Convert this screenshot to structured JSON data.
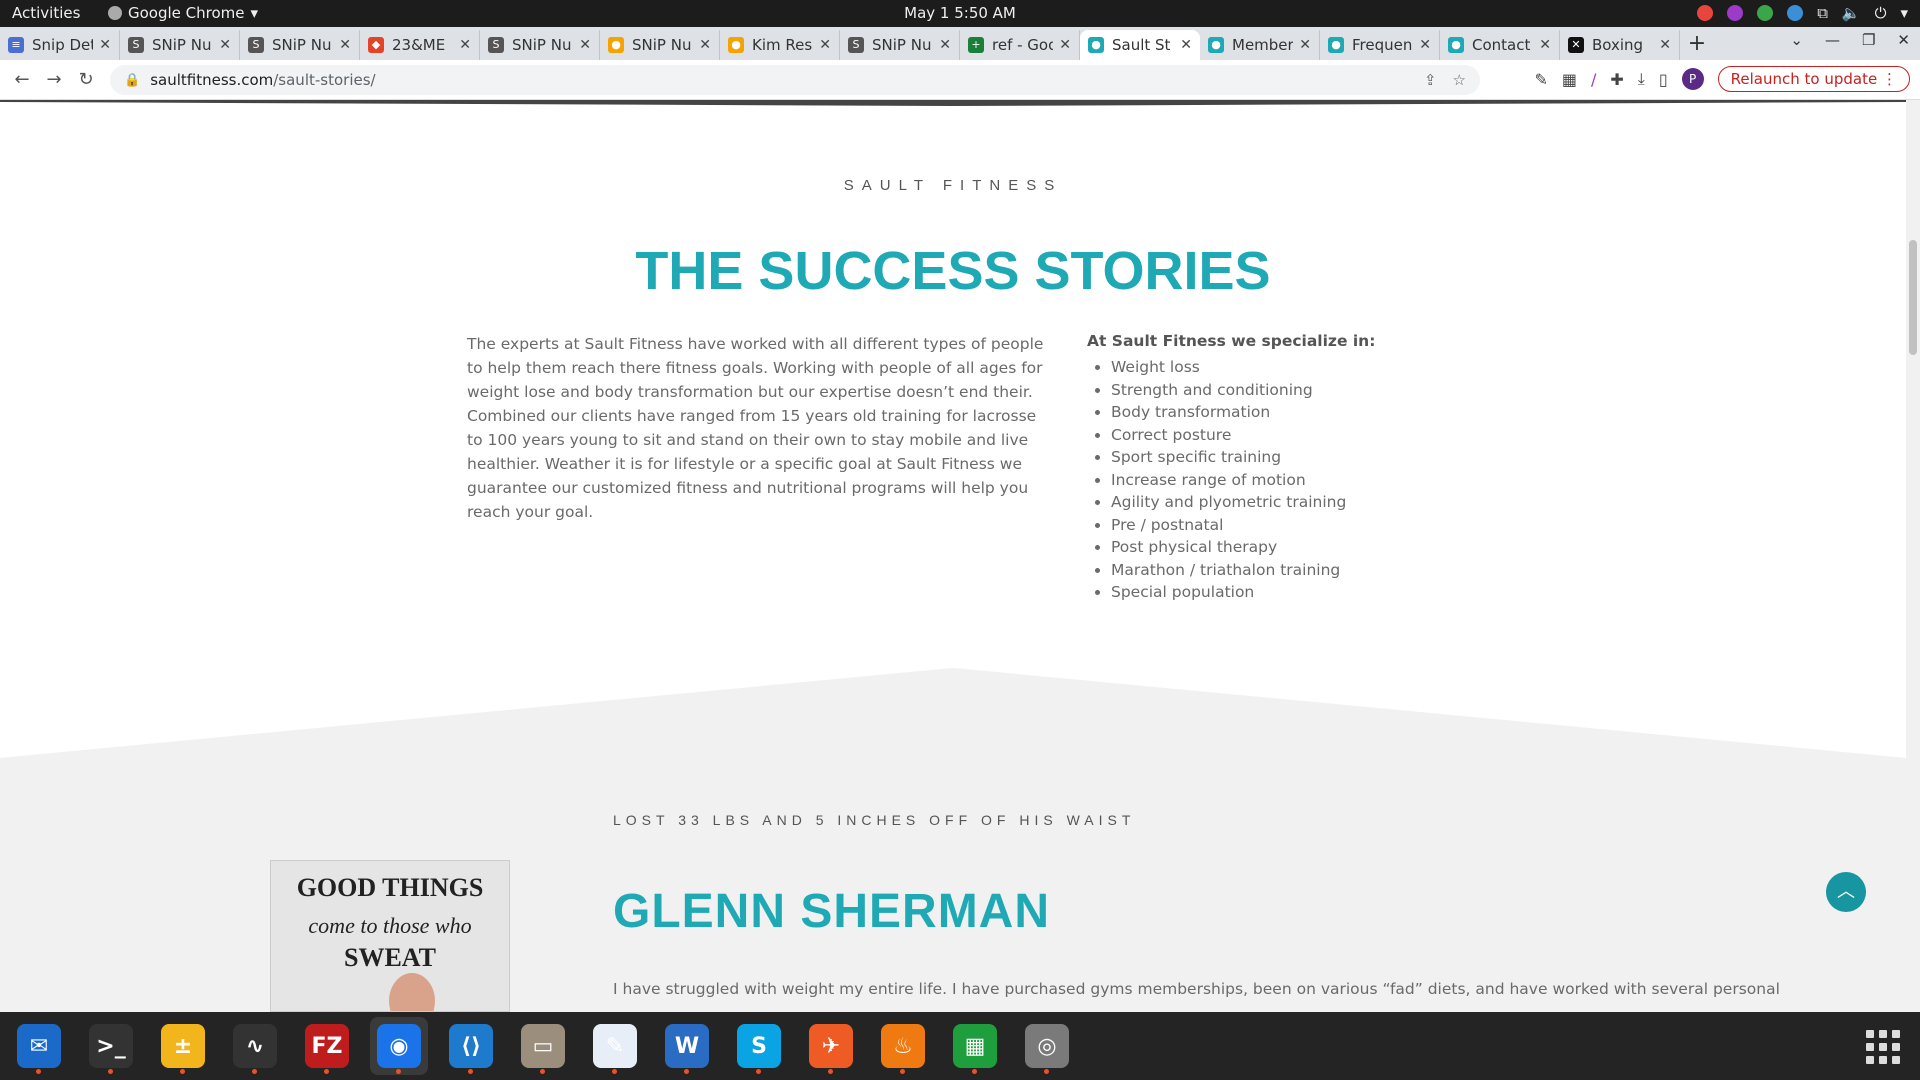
{
  "system": {
    "activities": "Activities",
    "app_name": "Google Chrome",
    "clock": "May 1  5:50 AM"
  },
  "tabs": [
    {
      "label": "Snip Det",
      "fav_color": "#4a6fd1",
      "fav_glyph": "≡"
    },
    {
      "label": "SNiP Nu",
      "fav_color": "#555555",
      "fav_glyph": "S"
    },
    {
      "label": "SNiP Nu",
      "fav_color": "#555555",
      "fav_glyph": "S"
    },
    {
      "label": "23&ME",
      "fav_color": "#e24329",
      "fav_glyph": "◆"
    },
    {
      "label": "SNiP Nu",
      "fav_color": "#555555",
      "fav_glyph": "S"
    },
    {
      "label": "SNiP Nu",
      "fav_color": "#f4a300",
      "fav_glyph": "●"
    },
    {
      "label": "Kim Res",
      "fav_color": "#f4a300",
      "fav_glyph": "●"
    },
    {
      "label": "SNiP Nu",
      "fav_color": "#555555",
      "fav_glyph": "S"
    },
    {
      "label": "ref - Goo",
      "fav_color": "#188038",
      "fav_glyph": "+"
    },
    {
      "label": "Sault St",
      "fav_color": "#1fa9b5",
      "fav_glyph": "●"
    },
    {
      "label": "Member",
      "fav_color": "#1fa9b5",
      "fav_glyph": "●"
    },
    {
      "label": "Frequen",
      "fav_color": "#1fa9b5",
      "fav_glyph": "●"
    },
    {
      "label": "Contact",
      "fav_color": "#1fa9b5",
      "fav_glyph": "●"
    },
    {
      "label": "Boxing",
      "fav_color": "#111111",
      "fav_glyph": "✕"
    }
  ],
  "active_tab_index": 9,
  "url": {
    "host": "saultfitness.com",
    "path": "/sault-stories/"
  },
  "toolbar": {
    "relaunch_label": "Relaunch to update",
    "avatar_letter": "P"
  },
  "page": {
    "eyebrow": "SAULT FITNESS",
    "title": "THE SUCCESS STORIES",
    "intro": "The experts at Sault Fitness have worked with all different types of people to help them reach there fitness goals. Working with people of all ages for weight lose and body transformation but our expertise doesn’t end their. Combined our clients have ranged from 15 years old training for lacrosse to 100 years young to sit and stand on their own to stay mobile and live healthier. Weather it is for lifestyle or a specific goal at Sault Fitness we guarantee our customized fitness and nutritional programs will help you reach your goal.",
    "specialize_title": "At Sault Fitness we specialize in:",
    "specialties": [
      "Weight loss",
      "Strength and conditioning",
      "Body transformation",
      "Correct posture",
      "Sport specific training",
      "Increase range of motion",
      "Agility and plyometric training",
      "Pre / postnatal",
      "Post physical therapy",
      "Marathon / triathalon training",
      "Special population"
    ],
    "story": {
      "eyebrow": "LOST 33 LBS AND 5 INCHES OFF OF HIS WAIST",
      "name": "GLENN SHERMAN",
      "text": "I have struggled with weight my entire life. I have purchased gyms memberships, been on various “fad” diets, and have worked with several personal",
      "photo_sign": [
        "GOOD THINGS",
        "come to those who",
        "SWEAT"
      ]
    }
  },
  "colors": {
    "accent": "#1fa9b5",
    "body_text": "#6a6a6a",
    "band": "#f1f1f1"
  },
  "dock": [
    {
      "name": "thunderbird-icon",
      "bg": "#1b6ac9",
      "glyph": "✉"
    },
    {
      "name": "terminal-icon",
      "bg": "#333333",
      "glyph": ">_"
    },
    {
      "name": "calculator-icon",
      "bg": "#f3b51c",
      "glyph": "±"
    },
    {
      "name": "system-monitor-icon",
      "bg": "#333333",
      "glyph": "∿"
    },
    {
      "name": "filezilla-icon",
      "bg": "#bf1d1d",
      "glyph": "FZ"
    },
    {
      "name": "chrome-icon",
      "bg": "#1a73e8",
      "glyph": "◉"
    },
    {
      "name": "vscode-icon",
      "bg": "#1e7acc",
      "glyph": "⟨⟩"
    },
    {
      "name": "files-icon",
      "bg": "#9c8e7c",
      "glyph": "▭"
    },
    {
      "name": "text-editor-icon",
      "bg": "#e8eef7",
      "glyph": "✎"
    },
    {
      "name": "libreoffice-writer-icon",
      "bg": "#2a6bc4",
      "glyph": "W"
    },
    {
      "name": "skype-icon",
      "bg": "#0aa3e3",
      "glyph": "S"
    },
    {
      "name": "postman-icon",
      "bg": "#ef5b25",
      "glyph": "✈"
    },
    {
      "name": "brasero-icon",
      "bg": "#f07a12",
      "glyph": "♨"
    },
    {
      "name": "libreoffice-calc-icon",
      "bg": "#1e9e3c",
      "glyph": "▦"
    },
    {
      "name": "disc-icon",
      "bg": "#7a7a7a",
      "glyph": "◎"
    }
  ],
  "dock_active_index": 5
}
